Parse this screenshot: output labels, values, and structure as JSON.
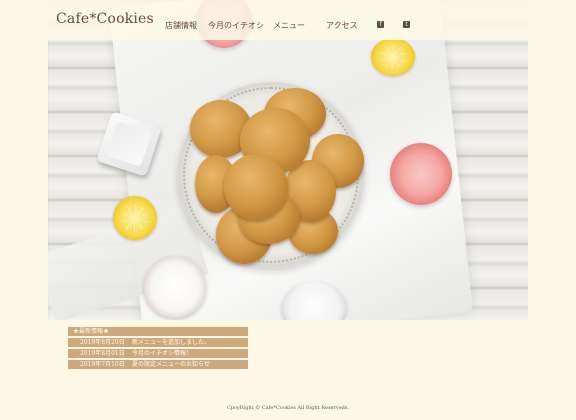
{
  "site": {
    "logo": "Cafe*Cookies"
  },
  "nav": {
    "items": [
      {
        "label": "店舗情報"
      },
      {
        "label": "今月のイチオシ"
      },
      {
        "label": "メニュー"
      },
      {
        "label": "アクセス"
      }
    ],
    "social": [
      {
        "icon": "facebook-icon",
        "glyph": "f"
      },
      {
        "icon": "twitter-icon",
        "glyph": "t"
      }
    ]
  },
  "hero": {
    "image": "cookies-on-plate-photo"
  },
  "news": {
    "title": "★最新情報★",
    "items": [
      {
        "date": "2019年8月20日",
        "text": "新メニューを追加しました。"
      },
      {
        "date": "2019年8月01日",
        "text": "今月のイチオシ情報！"
      },
      {
        "date": "2019年7月10日",
        "text": "夏の限定メニューのお知らせ"
      }
    ]
  },
  "footer": {
    "copyright": "CpoyRight © Cafe*Cookies All Right Reserveds."
  },
  "colors": {
    "background": "#fdf8e6",
    "news_bar": "#cea87a",
    "text_brown": "#6b4a3a"
  }
}
